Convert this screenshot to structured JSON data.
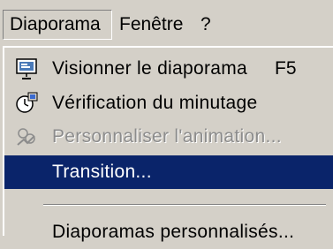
{
  "menubar": [
    {
      "id": "diaporama",
      "label": "Diaporama"
    },
    {
      "id": "fenetre",
      "label": "Fenêtre"
    },
    {
      "id": "help",
      "label": "?"
    }
  ],
  "menu": {
    "items": [
      {
        "label": "Visionner le diaporama",
        "shortcut": "F5",
        "icon": "slideshow-icon",
        "enabled": true,
        "selected": false
      },
      {
        "label": "Vérification du minutage",
        "icon": "stopwatch-icon",
        "enabled": true,
        "selected": false
      },
      {
        "label": "Personnaliser l'animation...",
        "icon": "animation-icon",
        "enabled": false,
        "selected": false
      },
      {
        "label": "Transition...",
        "enabled": true,
        "selected": true
      },
      {
        "label": "Diaporamas personnalisés...",
        "enabled": true,
        "selected": false
      }
    ]
  },
  "colors": {
    "menu_bg": "#d4d0c8",
    "highlight": "#0a246a",
    "disabled_text": "#8c8c8c"
  }
}
